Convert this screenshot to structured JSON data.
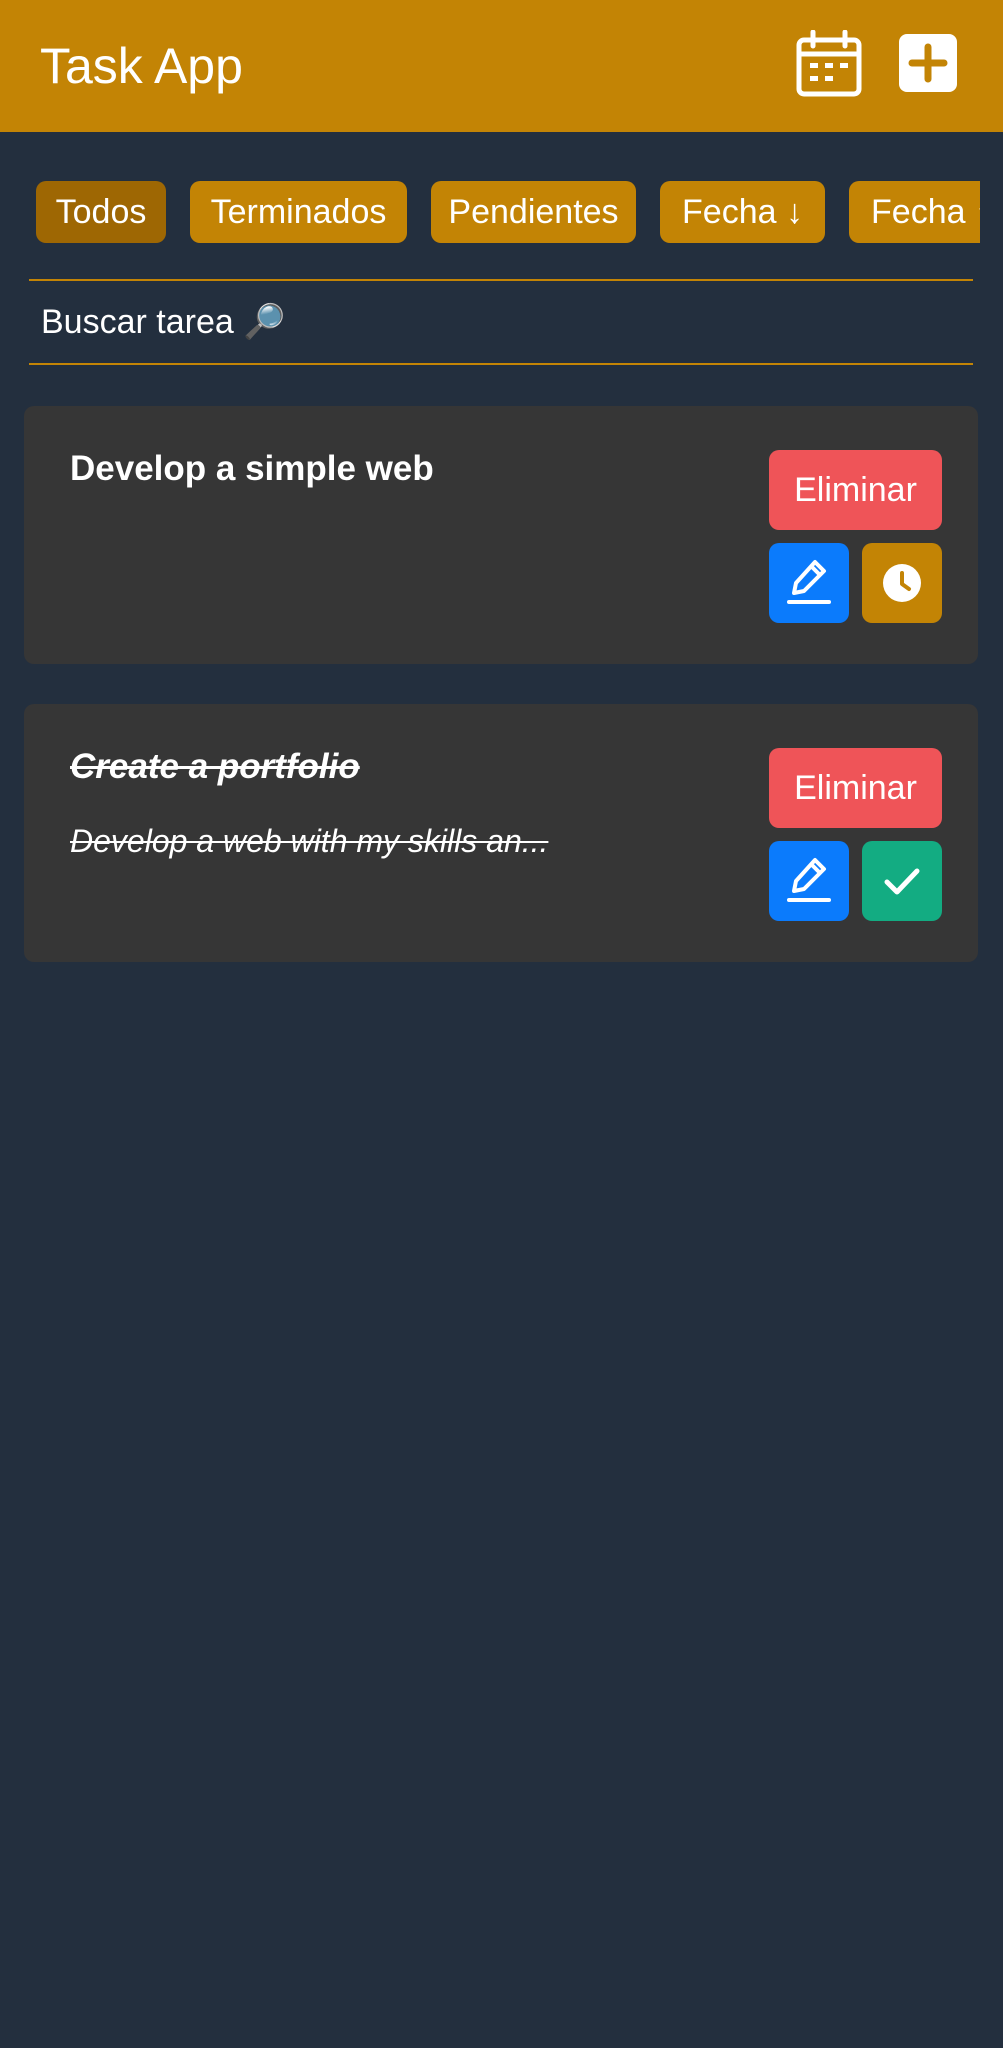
{
  "header": {
    "title": "Task App",
    "calendar_icon": "calendar-icon",
    "add_icon": "plus-square-icon",
    "background_color": "#c38405"
  },
  "filters": {
    "items": [
      {
        "label": "Todos",
        "active": true
      },
      {
        "label": "Terminados",
        "active": false
      },
      {
        "label": "Pendientes",
        "active": false
      },
      {
        "label": "Fecha ↓",
        "active": false
      },
      {
        "label": "Fecha ↑",
        "active": false
      }
    ]
  },
  "search": {
    "placeholder": "Buscar tarea 🔎"
  },
  "tasks": [
    {
      "title": "Develop a simple web",
      "description": "",
      "completed": false,
      "delete_label": "Eliminar",
      "edit_icon": "pencil-icon",
      "status_icon": "clock-icon"
    },
    {
      "title": "Create a portfolio",
      "description": "Develop a web with my skills an...",
      "completed": true,
      "delete_label": "Eliminar",
      "edit_icon": "pencil-icon",
      "status_icon": "check-icon"
    }
  ],
  "colors": {
    "background": "#232f3e",
    "accent": "#c38405",
    "accent_active": "#9e6703",
    "card": "#363636",
    "delete": "#ef5458",
    "edit": "#0b7bfc",
    "complete": "#13ac82"
  }
}
